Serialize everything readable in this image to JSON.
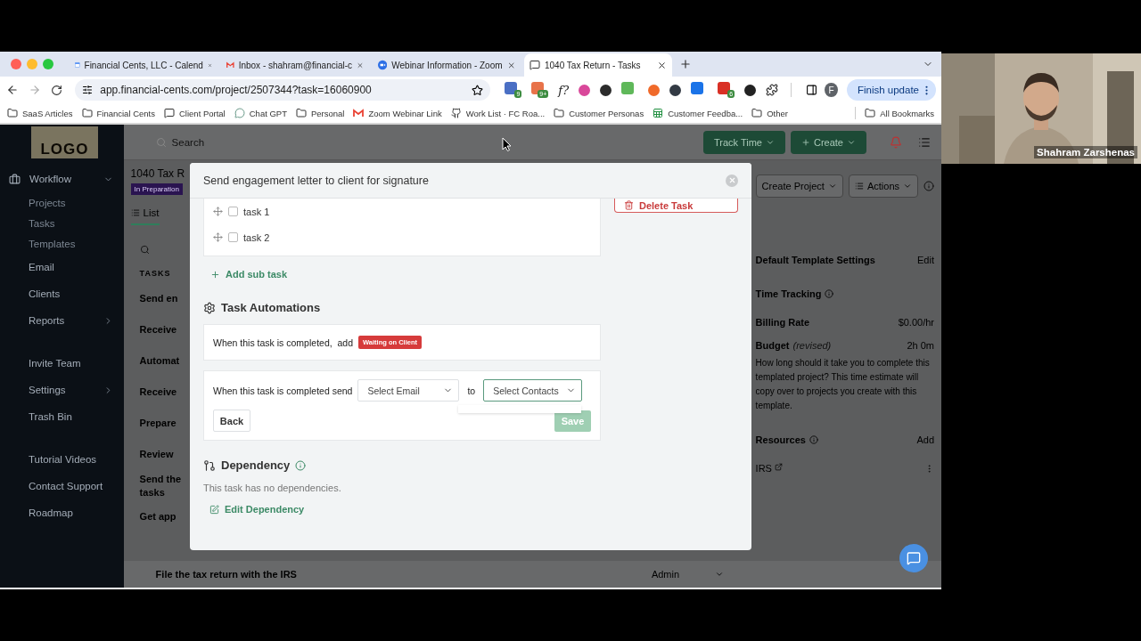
{
  "browser": {
    "tabs": [
      {
        "label": "Financial Cents, LLC - Calend",
        "kind": "calendar",
        "selected": false
      },
      {
        "label": "Inbox - shahram@financial-c",
        "kind": "mail",
        "selected": false
      },
      {
        "label": "Webinar Information - Zoom",
        "kind": "zoom",
        "selected": false
      },
      {
        "label": "1040 Tax Return - Tasks",
        "kind": "app",
        "selected": true
      }
    ],
    "url": "app.financial-cents.com/project/2507344?task=16060900",
    "extensions": [
      {
        "kind": "tile",
        "color": "#4a6fc4",
        "badge": "9"
      },
      {
        "kind": "tile",
        "color": "#e8734a",
        "badge": "9+"
      },
      {
        "kind": "glyph",
        "text": "f?"
      },
      {
        "kind": "dot",
        "color": "#d9489a"
      },
      {
        "kind": "dot",
        "color": "#2b2b2b"
      },
      {
        "kind": "tile",
        "color": "#5fb85a"
      },
      {
        "kind": "dot",
        "color": "#f06a2a"
      },
      {
        "kind": "dot",
        "color": "#333a44"
      },
      {
        "kind": "tile",
        "color": "#1a73e8"
      },
      {
        "kind": "tile",
        "color": "#d93025",
        "badge": "6"
      },
      {
        "kind": "dot",
        "color": "#222222"
      },
      {
        "kind": "puzzle"
      }
    ],
    "profile": "F",
    "update_button": "Finish update",
    "bookmarks": [
      {
        "label": "SaaS Articles",
        "kind": "folder"
      },
      {
        "label": "Financial Cents",
        "kind": "folder"
      },
      {
        "label": "Client Portal",
        "kind": "app"
      },
      {
        "label": "Chat GPT",
        "kind": "chat"
      },
      {
        "label": "Personal",
        "kind": "folder"
      },
      {
        "label": "Zoom Webinar Link",
        "kind": "mail"
      },
      {
        "label": "Work List · FC Roa...",
        "kind": "github"
      },
      {
        "label": "Customer Personas",
        "kind": "folder"
      },
      {
        "label": "Customer Feedba...",
        "kind": "sheet"
      },
      {
        "label": "Other",
        "kind": "folder"
      }
    ],
    "all_bookmarks": "All Bookmarks"
  },
  "video": {
    "name": "Shahram Zarshenas"
  },
  "app": {
    "sidebar": {
      "logo": "LOGO",
      "sections": [
        [
          {
            "label": "Workflow",
            "kind": "group",
            "expanded": true,
            "children": [
              {
                "label": "Projects"
              },
              {
                "label": "Tasks"
              },
              {
                "label": "Templates"
              }
            ]
          },
          {
            "label": "Email",
            "kind": "link"
          },
          {
            "label": "Clients",
            "kind": "link"
          },
          {
            "label": "Reports",
            "kind": "group",
            "expanded": false
          }
        ],
        [
          {
            "label": "Invite Team",
            "kind": "link"
          },
          {
            "label": "Settings",
            "kind": "group",
            "expanded": false
          },
          {
            "label": "Trash Bin",
            "kind": "link"
          }
        ],
        [
          {
            "label": "Tutorial Videos",
            "kind": "link"
          },
          {
            "label": "Contact Support",
            "kind": "link"
          },
          {
            "label": "Roadmap",
            "kind": "link"
          }
        ]
      ]
    },
    "header": {
      "search_placeholder": "Search",
      "track_button": "Track Time",
      "create_button": "Create"
    },
    "project": {
      "title": "1040 Tax R",
      "status": "In Preparation",
      "tabs": [
        {
          "label": "List",
          "selected": true
        }
      ],
      "tasks_heading": "TASKS",
      "tasks": [
        "Send en",
        "Receive",
        "Automat",
        "Receive",
        "Prepare",
        "Review",
        "Send the tasks",
        "Get app"
      ],
      "last_task": {
        "name": "File the tax return with the IRS",
        "assignee": "Admin"
      }
    },
    "right_panel": {
      "buttons": [
        "Create Project",
        "Actions"
      ],
      "settings_title": "Default Template Settings",
      "edit": "Edit",
      "time_tracking": "Time Tracking",
      "billing_label": "Billing Rate",
      "billing_value": "$0.00/hr",
      "budget_label": "Budget",
      "budget_note": "(revised)",
      "budget_value": "2h 0m",
      "budget_help": "How long should it take you to complete this templated project? This time estimate will copy over to projects you create with this template.",
      "resources_title": "Resources",
      "add": "Add",
      "resources": [
        {
          "label": "IRS"
        }
      ]
    }
  },
  "modal": {
    "title": "Send engagement letter to client for signature",
    "delete_button": "Delete Task",
    "subtasks": [
      {
        "label": "task 1",
        "checked": false
      },
      {
        "label": "task 2",
        "checked": false
      }
    ],
    "add_subtask": "Add sub task",
    "automations_title": "Task Automations",
    "tag_rule": {
      "text": "When this task is completed,  add",
      "tag": "Waiting on Client"
    },
    "email_rule": {
      "text": "When this task is completed send",
      "email": {
        "placeholder": "Select Email",
        "focused": false
      },
      "joiner": "to",
      "contacts": {
        "placeholder": "Select Contacts",
        "focused": true
      },
      "back": "Back",
      "save": {
        "label": "Save",
        "disabled": true
      }
    },
    "dependency": {
      "title": "Dependency",
      "empty": "This task has no dependencies.",
      "edit": "Edit Dependency"
    }
  }
}
